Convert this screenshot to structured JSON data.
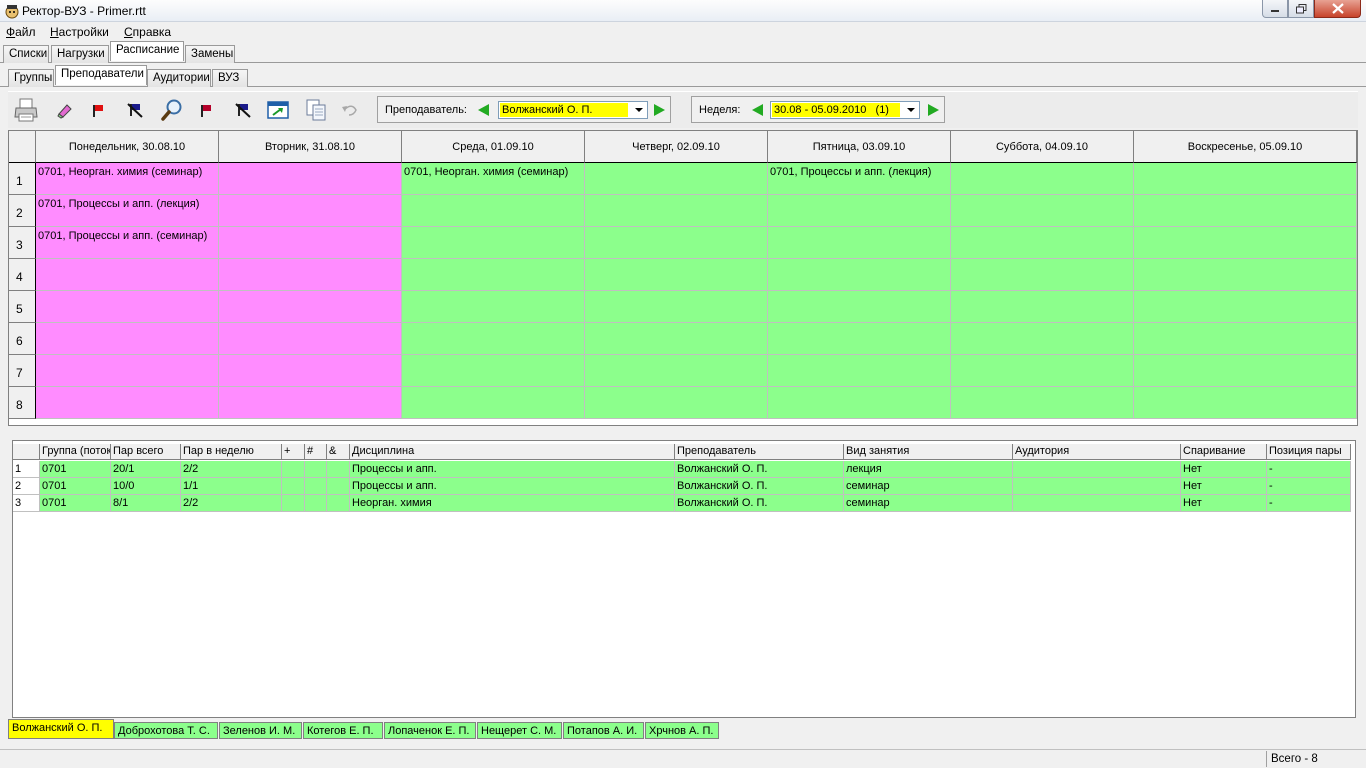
{
  "window": {
    "title": "Ректор-ВУЗ - Primer.rtt"
  },
  "menu": [
    {
      "accel": "Ф",
      "rest": "айл"
    },
    {
      "accel": "Н",
      "rest": "астройки"
    },
    {
      "accel": "С",
      "rest": "правка"
    }
  ],
  "main_tabs": [
    "Списки",
    "Нагрузки",
    "Расписание",
    "Замены"
  ],
  "sub_tabs": [
    "Группы",
    "Преподаватели",
    "Аудитории",
    "ВУЗ"
  ],
  "toolbar": {
    "icons": [
      "printer-icon",
      "eraser-icon",
      "red-flag-icon",
      "clear-flag-icon",
      "magnifier-icon",
      "red-flag-icon",
      "clear-flag-icon",
      "export-icon",
      "copy-icon",
      "undo-icon"
    ],
    "teacher_label": "Преподаватель:",
    "teacher_value": "Волжанский О. П.",
    "week_label": "Неделя:",
    "week_value": "30.08 - 05.09.2010   (1)",
    "highlight_color": "#ffff00",
    "arrow_color": "#22aa22"
  },
  "schedule": {
    "days": [
      "Понедельник, 30.08.10",
      "Вторник, 31.08.10",
      "Среда, 01.09.10",
      "Четверг, 02.09.10",
      "Пятница, 03.09.10",
      "Суббота, 04.09.10",
      "Воскресенье, 05.09.10"
    ],
    "rows": [
      "1",
      "2",
      "3",
      "4",
      "5",
      "6",
      "7",
      "8"
    ],
    "day_colors": [
      "pink",
      "pink",
      "green",
      "green",
      "green",
      "green",
      "green"
    ],
    "colors": {
      "pink": "#ff8cff",
      "green": "#8cff8c"
    },
    "cells": [
      [
        "0701, Неорган. химия (семинар)",
        "",
        "0701, Неорган. химия (семинар)",
        "",
        "0701, Процессы и апп. (лекция)",
        "",
        ""
      ],
      [
        "0701, Процессы и апп. (лекция)",
        "",
        "",
        "",
        "",
        "",
        ""
      ],
      [
        "0701, Процессы и апп. (семинар)",
        "",
        "",
        "",
        "",
        "",
        ""
      ],
      [
        "",
        "",
        "",
        "",
        "",
        "",
        ""
      ],
      [
        "",
        "",
        "",
        "",
        "",
        "",
        ""
      ],
      [
        "",
        "",
        "",
        "",
        "",
        "",
        ""
      ],
      [
        "",
        "",
        "",
        "",
        "",
        "",
        ""
      ],
      [
        "",
        "",
        "",
        "",
        "",
        "",
        ""
      ]
    ]
  },
  "load_table": {
    "columns": [
      "Группа (поток)",
      "Пар всего",
      "Пар в неделю",
      "+",
      "#",
      "&",
      "Дисциплина",
      "Преподаватель",
      "Вид занятия",
      "Аудитория",
      "Спаривание",
      "Позиция пары"
    ],
    "rows": [
      [
        "1",
        "0701",
        "20/1",
        "2/2",
        "",
        "",
        "",
        "Процессы и апп.",
        "Волжанский О. П.",
        "лекция",
        "",
        "Нет",
        "-"
      ],
      [
        "2",
        "0701",
        "10/0",
        "1/1",
        "",
        "",
        "",
        "Процессы и апп.",
        "Волжанский О. П.",
        "семинар",
        "",
        "Нет",
        "-"
      ],
      [
        "3",
        "0701",
        "8/1",
        "2/2",
        "",
        "",
        "",
        "Неорган. химия",
        "Волжанский О. П.",
        "семинар",
        "",
        "Нет",
        "-"
      ]
    ]
  },
  "teacher_tabs": [
    "Волжанский О. П.",
    "Доброхотова Т. С.",
    "Зеленов И. М.",
    "Котегов Е. П.",
    "Лопаченок Е. П.",
    "Нещерет С. М.",
    "Потапов А. И.",
    "Хрчнов А. П."
  ],
  "status": {
    "total": "Всего - 8"
  }
}
